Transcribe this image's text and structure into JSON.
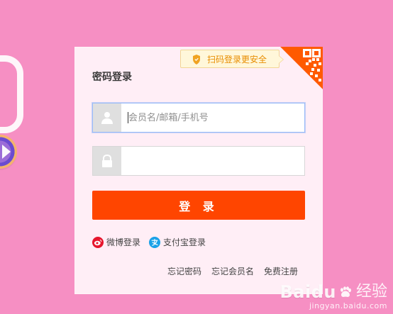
{
  "login": {
    "title": "密码登录",
    "security_tip": "扫码登录更安全",
    "username_placeholder": "会员名/邮箱/手机号",
    "password_value": "",
    "submit_label": "登 录",
    "social": {
      "weibo_label": "微博登录",
      "alipay_label": "支付宝登录"
    },
    "links": {
      "forgot_password": "忘记密码",
      "forgot_username": "忘记会员名",
      "register": "免费注册"
    }
  },
  "watermark": {
    "brand": "Baidu",
    "cn": "经验",
    "url": "jingyan.baidu.com"
  },
  "icons": {
    "security": "shield-icon",
    "qr": "qr-code-icon",
    "user": "user-icon",
    "password": "lock-icon",
    "weibo": "weibo-icon",
    "alipay": "alipay-icon",
    "watermark": "baidu-paw-icon"
  },
  "colors": {
    "background": "#f68fc3",
    "panel": "#ffeef6",
    "primary": "#ff4500",
    "tip_text": "#e88d00",
    "tip_background": "#fff7da",
    "input_focus": "#9bbcf7",
    "qr_orange": "#ff5a00"
  }
}
